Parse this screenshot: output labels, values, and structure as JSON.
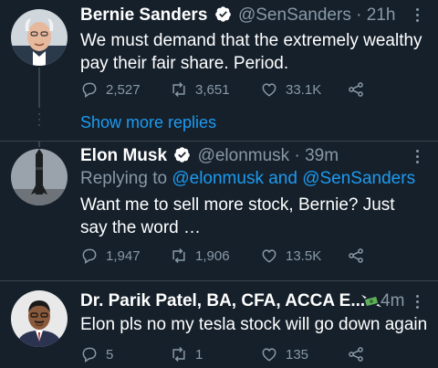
{
  "tweets": [
    {
      "name": "Bernie Sanders",
      "handle": "@SenSanders",
      "sep": "·",
      "time": "21h",
      "text": "We must demand that the extremely wealthy pay their fair share. Period.",
      "replies": "2,527",
      "retweets": "3,651",
      "likes": "33.1K"
    },
    {
      "name": "Elon Musk",
      "handle": "@elonmusk",
      "sep": "·",
      "time": "39m",
      "reply_prefix": "Replying to ",
      "reply_targets": "@elonmusk and @SenSanders",
      "text": "Want me to sell more stock, Bernie? Just say the word …",
      "replies": "1,947",
      "retweets": "1,906",
      "likes": "13.5K"
    },
    {
      "name": "Dr. Parik Patel, BA, CFA, ACCA E...",
      "time": "4m",
      "text": "Elon pls no my tesla stock will go down again",
      "replies": "5",
      "retweets": "1",
      "likes": "135"
    }
  ],
  "show_more": "Show more replies",
  "colors": {
    "background": "#15202b",
    "link": "#1d9bf0",
    "muted": "#8899a6",
    "verified": "#ffffff"
  },
  "icons": [
    "verified-badge-icon",
    "more-options-icon",
    "reply-icon",
    "retweet-icon",
    "like-icon",
    "share-icon",
    "money-wings-icon"
  ]
}
